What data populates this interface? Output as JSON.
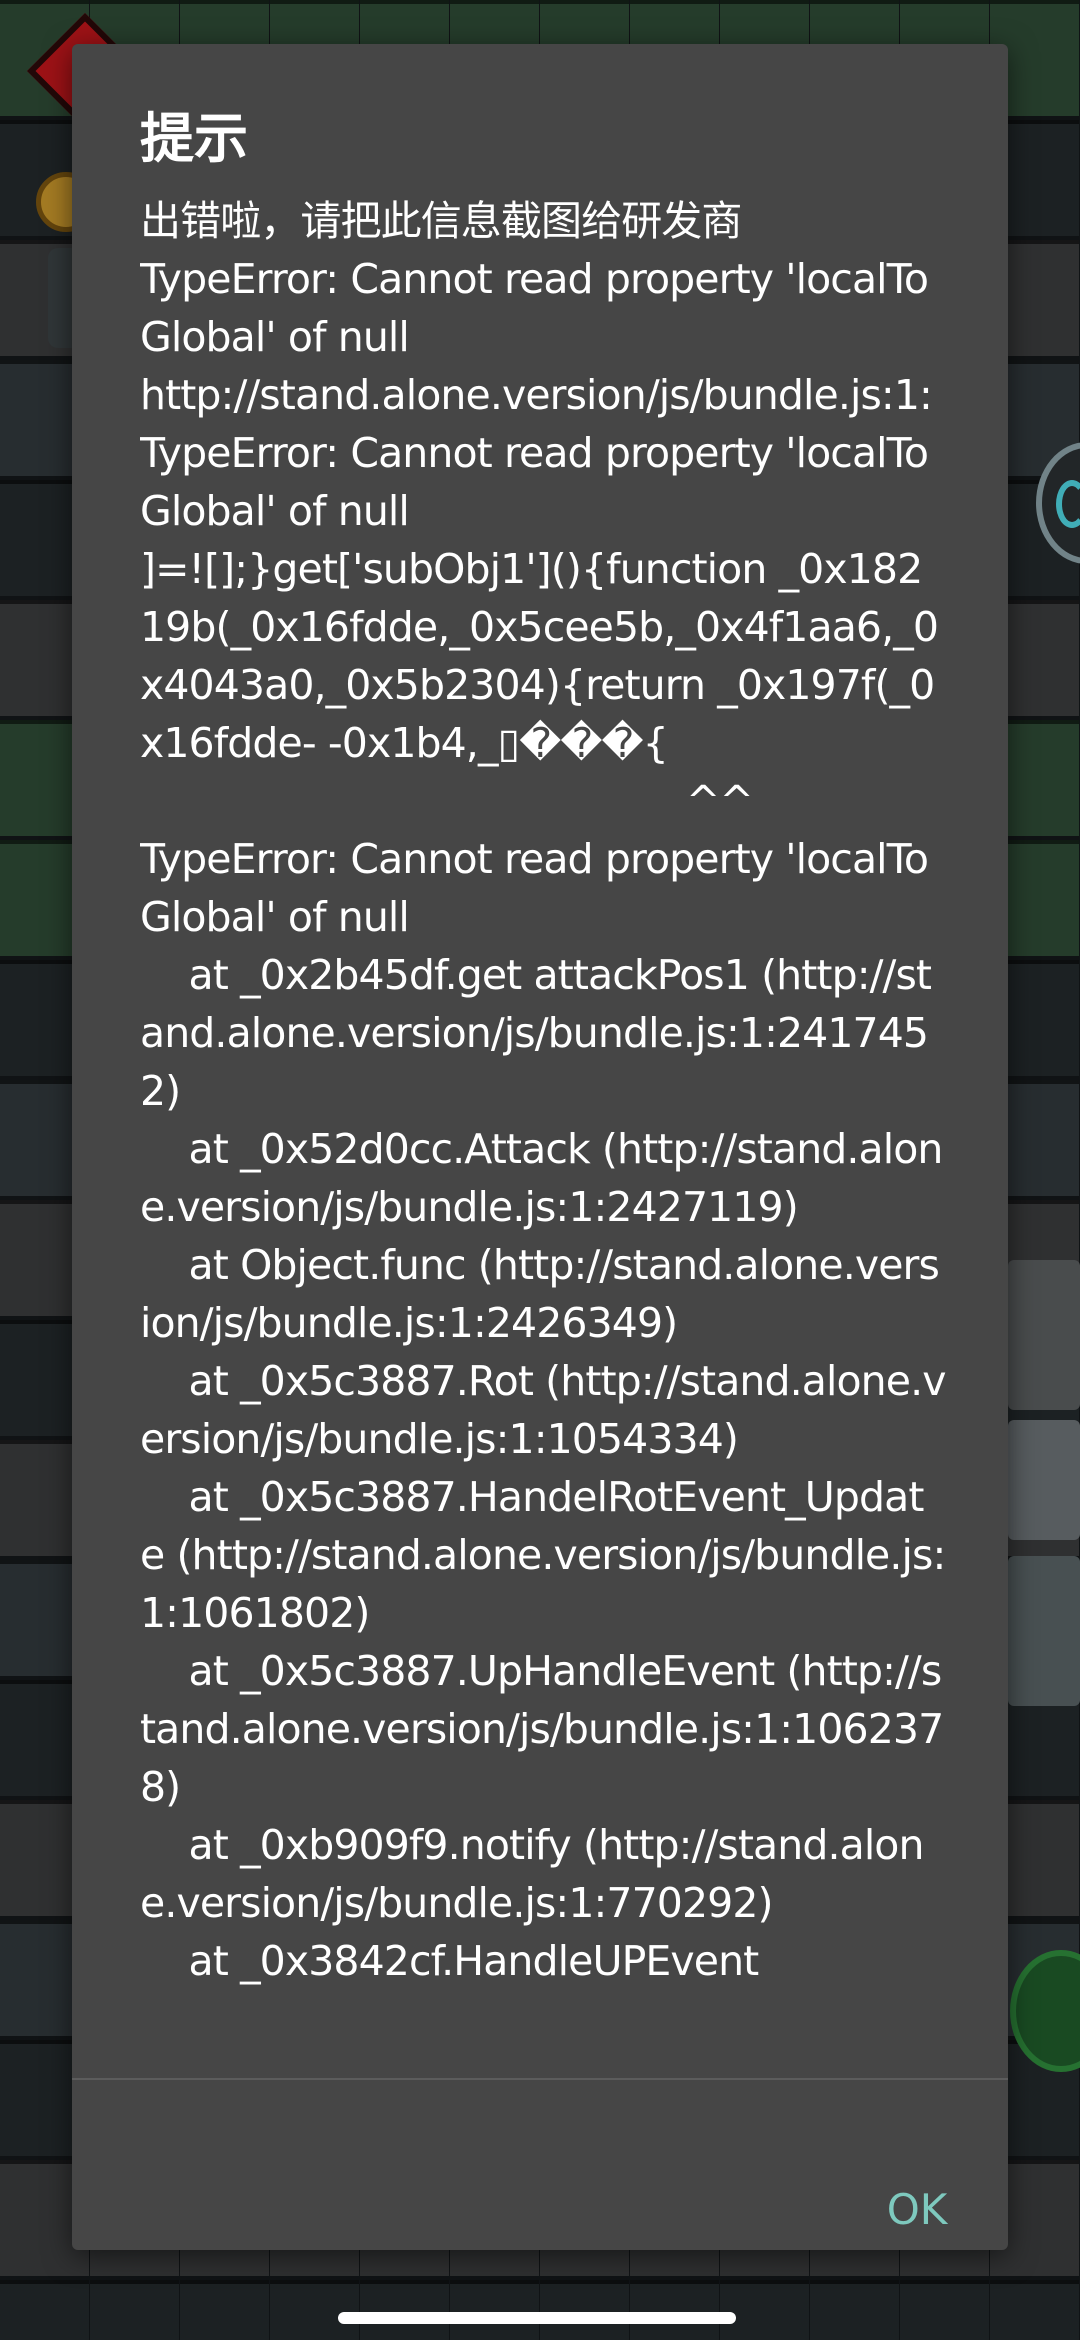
{
  "dialog": {
    "title": "提示",
    "message": "出错啦，请把此信息截图给研发商\nTypeError: Cannot read property 'localToGlobal' of null\nhttp://stand.alone.version/js/bundle.js:1:\nTypeError: Cannot read property 'localToGlobal' of null\n]=![];}get['subObj1'](){function _0x18219b(_0x16fdde,_0x5cee5b,_0x4f1aa6,_0x4043a0,_0x5b2304){return _0x197f(_0x16fdde- -0x1b4,_▯���{\n                                             ^^\nTypeError: Cannot read property 'localToGlobal' of null\n    at _0x2b45df.get attackPos1 (http://stand.alone.version/js/bundle.js:1:2417452)\n    at _0x52d0cc.Attack (http://stand.alone.version/js/bundle.js:1:2427119)\n    at Object.func (http://stand.alone.version/js/bundle.js:1:2426349)\n    at _0x5c3887.Rot (http://stand.alone.version/js/bundle.js:1:1054334)\n    at _0x5c3887.HandelRotEvent_Update (http://stand.alone.version/js/bundle.js:1:1061802)\n    at _0x5c3887.UpHandleEvent (http://stand.alone.version/js/bundle.js:1:1062378)\n    at _0xb909f9.notify (http://stand.alone.version/js/bundle.js:1:770292)\n    at _0x3842cf.HandleUPEvent",
    "ok_label": "OK"
  },
  "colors": {
    "dialog_bg": "#464646",
    "accent": "#7ec9be",
    "text": "#ffffff"
  }
}
